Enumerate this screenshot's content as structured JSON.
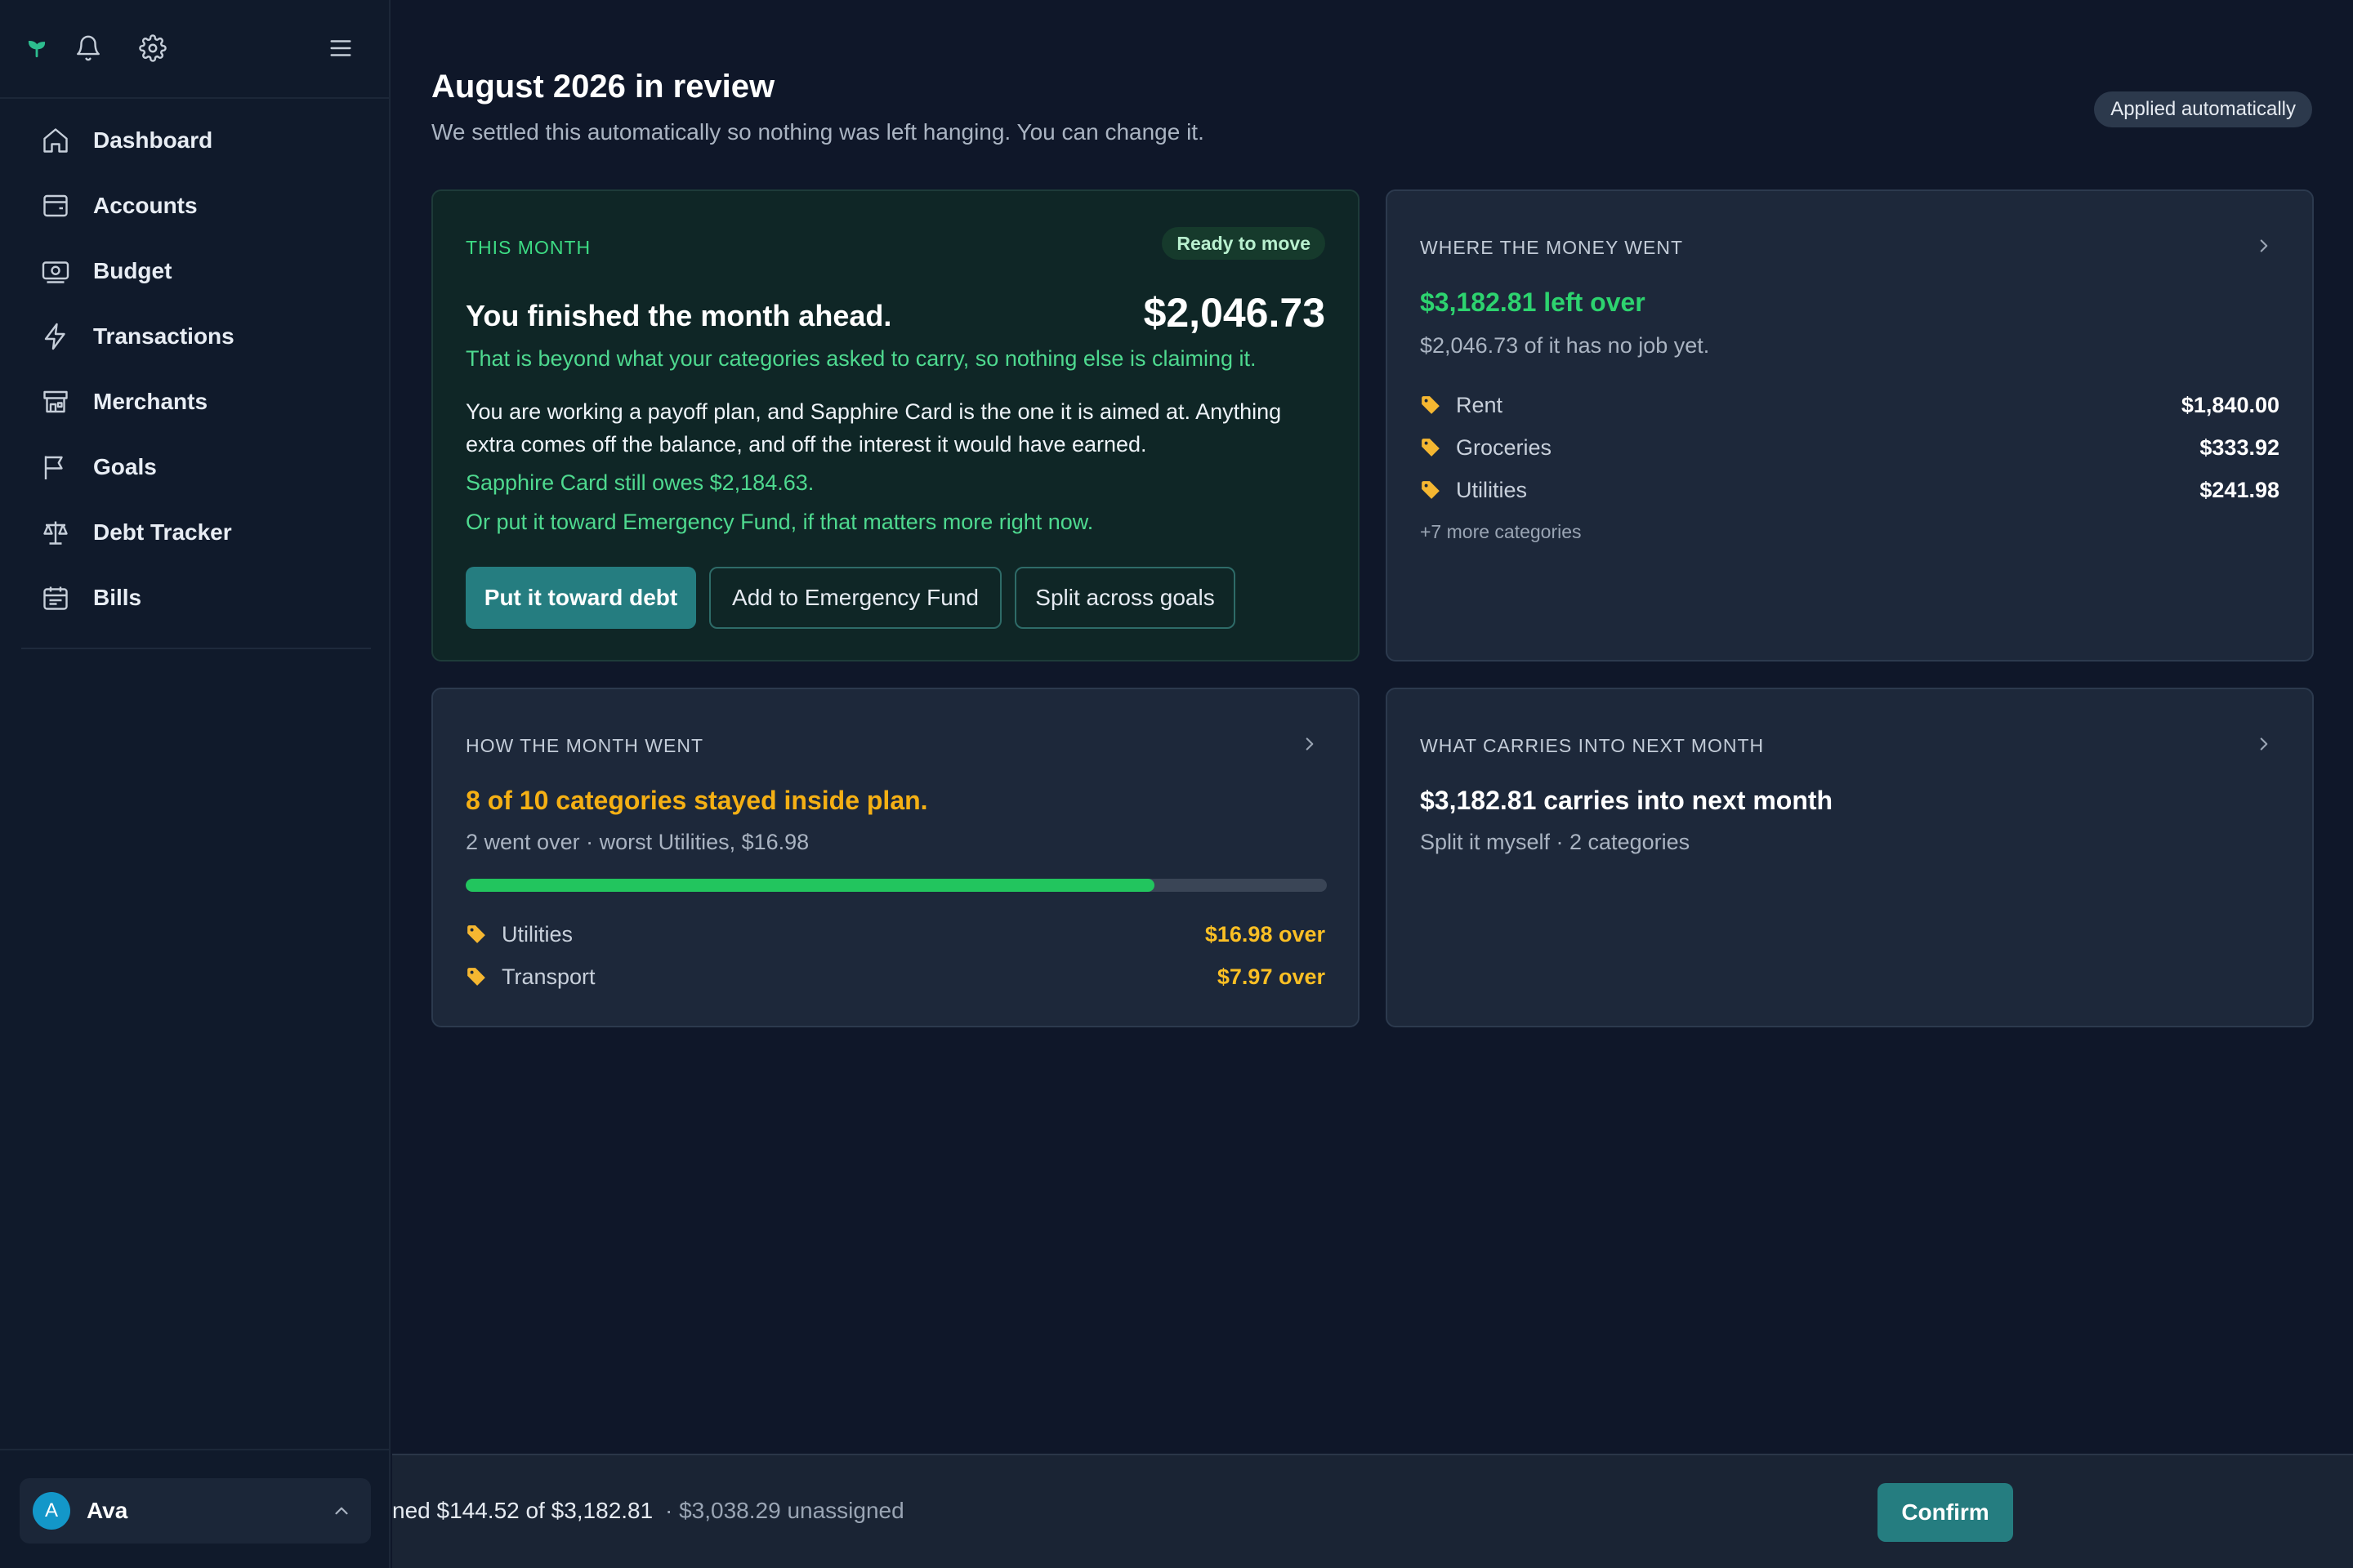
{
  "sidebar": {
    "top_icons": [
      "logo-sprout-icon",
      "bell-icon",
      "gear-icon",
      "menu-icon"
    ],
    "nav": [
      {
        "label": "Dashboard",
        "icon": "home-icon"
      },
      {
        "label": "Accounts",
        "icon": "wallet-icon"
      },
      {
        "label": "Budget",
        "icon": "banknote-icon"
      },
      {
        "label": "Transactions",
        "icon": "lightning-icon"
      },
      {
        "label": "Merchants",
        "icon": "store-icon"
      },
      {
        "label": "Goals",
        "icon": "flag-icon"
      },
      {
        "label": "Debt Tracker",
        "icon": "scale-icon"
      },
      {
        "label": "Bills",
        "icon": "calendar-icon"
      }
    ],
    "user": {
      "initial": "A",
      "name": "Ava"
    }
  },
  "header": {
    "title": "August 2026 in review",
    "subtitle": "We settled this automatically so nothing was left hanging. You can change it.",
    "badge": "Applied automatically"
  },
  "this_month": {
    "label": "THIS MONTH",
    "badge": "Ready to move",
    "headline": "You finished the month ahead.",
    "amount": "$2,046.73",
    "note": "That is beyond what your categories asked to carry, so nothing else is claiming it.",
    "body": "You are working a payoff plan, and Sapphire Card is the one it is aimed at. Anything extra comes off the balance, and off the interest it would have earned.",
    "owes": "Sapphire Card still owes $2,184.63.",
    "alt": "Or put it toward Emergency Fund, if that matters more right now.",
    "buttons": {
      "primary": "Put it toward debt",
      "secondary": "Add to Emergency Fund",
      "tertiary": "Split across goals"
    }
  },
  "where_money_went": {
    "label": "WHERE THE MONEY WENT",
    "headline": "$3,182.81 left over",
    "sub": "$2,046.73 of it has no job yet.",
    "rows": [
      {
        "label": "Rent",
        "value": "$1,840.00"
      },
      {
        "label": "Groceries",
        "value": "$333.92"
      },
      {
        "label": "Utilities",
        "value": "$241.98"
      }
    ],
    "more": "+7 more categories"
  },
  "how_month_went": {
    "label": "HOW THE MONTH WENT",
    "headline": "8 of 10 categories stayed inside plan.",
    "sub": "2 went over · worst Utilities, $16.98",
    "progress": 0.8,
    "rows": [
      {
        "label": "Utilities",
        "value": "$16.98 over"
      },
      {
        "label": "Transport",
        "value": "$7.97 over"
      }
    ]
  },
  "carries": {
    "label": "WHAT CARRIES INTO NEXT MONTH",
    "headline": "$3,182.81 carries into next month",
    "sub": "Split it myself · 2 categories"
  },
  "bottom_bar": {
    "assigned": "ned $144.52 of $3,182.81",
    "unassigned": "· $3,038.29 unassigned",
    "confirm": "Confirm"
  },
  "colors": {
    "background": "#0f1729",
    "accent_teal": "#257d80",
    "positive_green": "#2dd36f",
    "warning_amber": "#f5b014"
  }
}
